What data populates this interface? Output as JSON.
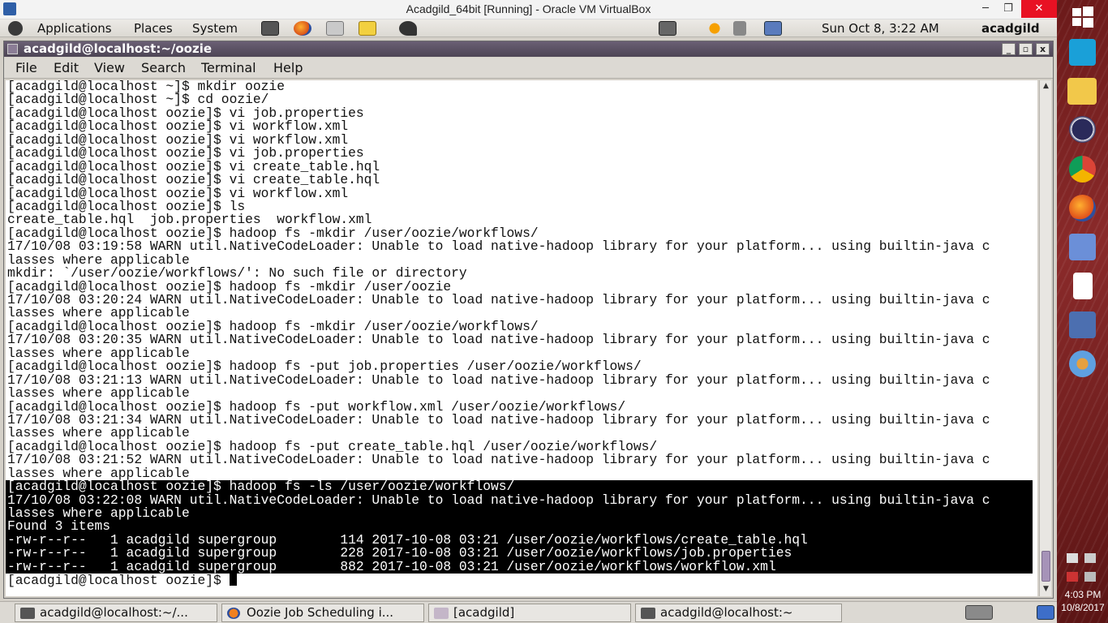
{
  "vbox": {
    "title": "Acadgild_64bit [Running] - Oracle VM VirtualBox",
    "minimize": "─",
    "maximize": "❐",
    "close": "✕"
  },
  "gnome_panel": {
    "menus": [
      "Applications",
      "Places",
      "System"
    ],
    "datetime": "Sun Oct  8,  3:22 AM",
    "user": "acadgild"
  },
  "terminal": {
    "title": "acadgild@localhost:~/oozie",
    "menu": [
      "File",
      "Edit",
      "View",
      "Search",
      "Terminal",
      "Help"
    ],
    "lines": [
      "[acadgild@localhost ~]$ mkdir oozie",
      "[acadgild@localhost ~]$ cd oozie/",
      "[acadgild@localhost oozie]$ vi job.properties",
      "[acadgild@localhost oozie]$ vi workflow.xml",
      "[acadgild@localhost oozie]$ vi workflow.xml",
      "[acadgild@localhost oozie]$ vi job.properties",
      "[acadgild@localhost oozie]$ vi create_table.hql",
      "[acadgild@localhost oozie]$ vi create_table.hql",
      "[acadgild@localhost oozie]$ vi workflow.xml",
      "[acadgild@localhost oozie]$ ls",
      "create_table.hql  job.properties  workflow.xml",
      "[acadgild@localhost oozie]$ hadoop fs -mkdir /user/oozie/workflows/",
      "17/10/08 03:19:58 WARN util.NativeCodeLoader: Unable to load native-hadoop library for your platform... using builtin-java c",
      "lasses where applicable",
      "mkdir: `/user/oozie/workflows/': No such file or directory",
      "[acadgild@localhost oozie]$ hadoop fs -mkdir /user/oozie",
      "17/10/08 03:20:24 WARN util.NativeCodeLoader: Unable to load native-hadoop library for your platform... using builtin-java c",
      "lasses where applicable",
      "[acadgild@localhost oozie]$ hadoop fs -mkdir /user/oozie/workflows/",
      "17/10/08 03:20:35 WARN util.NativeCodeLoader: Unable to load native-hadoop library for your platform... using builtin-java c",
      "lasses where applicable",
      "[acadgild@localhost oozie]$ hadoop fs -put job.properties /user/oozie/workflows/",
      "17/10/08 03:21:13 WARN util.NativeCodeLoader: Unable to load native-hadoop library for your platform... using builtin-java c",
      "lasses where applicable",
      "[acadgild@localhost oozie]$ hadoop fs -put workflow.xml /user/oozie/workflows/",
      "17/10/08 03:21:34 WARN util.NativeCodeLoader: Unable to load native-hadoop library for your platform... using builtin-java c",
      "lasses where applicable",
      "[acadgild@localhost oozie]$ hadoop fs -put create_table.hql /user/oozie/workflows/",
      "17/10/08 03:21:52 WARN util.NativeCodeLoader: Unable to load native-hadoop library for your platform... using builtin-java c",
      "lasses where applicable"
    ],
    "selected_lines": [
      "[acadgild@localhost oozie]$ hadoop fs -ls /user/oozie/workflows/",
      "17/10/08 03:22:08 WARN util.NativeCodeLoader: Unable to load native-hadoop library for your platform... using builtin-java c",
      "lasses where applicable",
      "Found 3 items",
      "-rw-r--r--   1 acadgild supergroup        114 2017-10-08 03:21 /user/oozie/workflows/create_table.hql",
      "-rw-r--r--   1 acadgild supergroup        228 2017-10-08 03:21 /user/oozie/workflows/job.properties",
      "-rw-r--r--   1 acadgild supergroup        882 2017-10-08 03:21 /user/oozie/workflows/workflow.xml"
    ],
    "prompt": "[acadgild@localhost oozie]$ "
  },
  "guest_taskbar": {
    "tasks": [
      {
        "label": "acadgild@localhost:~/...",
        "icon": "terminal-icon"
      },
      {
        "label": "Oozie Job Scheduling i...",
        "icon": "firefox-icon"
      },
      {
        "label": "[acadgild]",
        "icon": "folder-icon"
      },
      {
        "label": "acadgild@localhost:~",
        "icon": "terminal-icon"
      }
    ]
  },
  "windows_host": {
    "time": "4:03 PM",
    "date": "10/8/2017"
  },
  "colors": {
    "terminal_bg": "#ffffff",
    "selection_bg": "#000000",
    "titlebar_purple": "#4d4555",
    "win_close": "#e81123"
  }
}
